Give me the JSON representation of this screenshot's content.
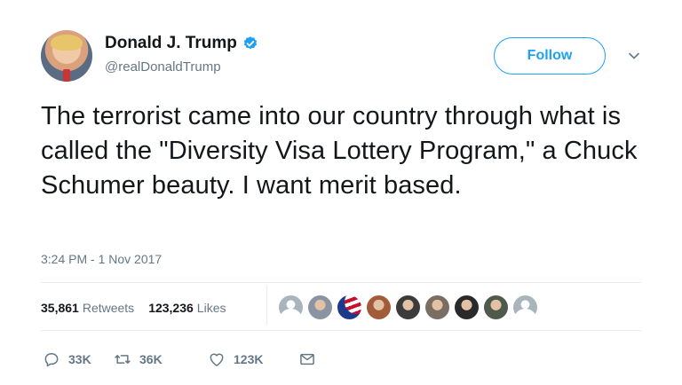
{
  "author": {
    "name": "Donald J. Trump",
    "handle": "@realDonaldTrump",
    "verified": true
  },
  "follow_label": "Follow",
  "tweet": {
    "text": "The terrorist came into our country through what is called the \"Diversity Visa Lottery Program,\" a Chuck Schumer beauty. I want merit based.",
    "timestamp": "3:24 PM - 1 Nov 2017"
  },
  "stats": {
    "retweets_count": "35,861",
    "retweets_label": "Retweets",
    "likes_count": "123,236",
    "likes_label": "Likes"
  },
  "likers": [
    {
      "icon": "default-avatar",
      "color": "#a9b4bd"
    },
    {
      "icon": "user-avatar",
      "color": "#8a94a3"
    },
    {
      "icon": "flag-avatar",
      "color": "#1d3a8a"
    },
    {
      "icon": "user-avatar",
      "color": "#a35c3a"
    },
    {
      "icon": "user-avatar",
      "color": "#3b3b3b"
    },
    {
      "icon": "user-avatar",
      "color": "#7a6d62"
    },
    {
      "icon": "user-avatar",
      "color": "#2a2a2a"
    },
    {
      "icon": "user-avatar",
      "color": "#4f5a4d"
    },
    {
      "icon": "default-avatar",
      "color": "#a9b4bd"
    }
  ],
  "actions": {
    "reply_count": "33K",
    "retweet_count": "36K",
    "like_count": "123K"
  },
  "colors": {
    "accent": "#1da1f2",
    "text": "#14171a",
    "muted": "#657786",
    "divider": "#e6ecf0"
  }
}
